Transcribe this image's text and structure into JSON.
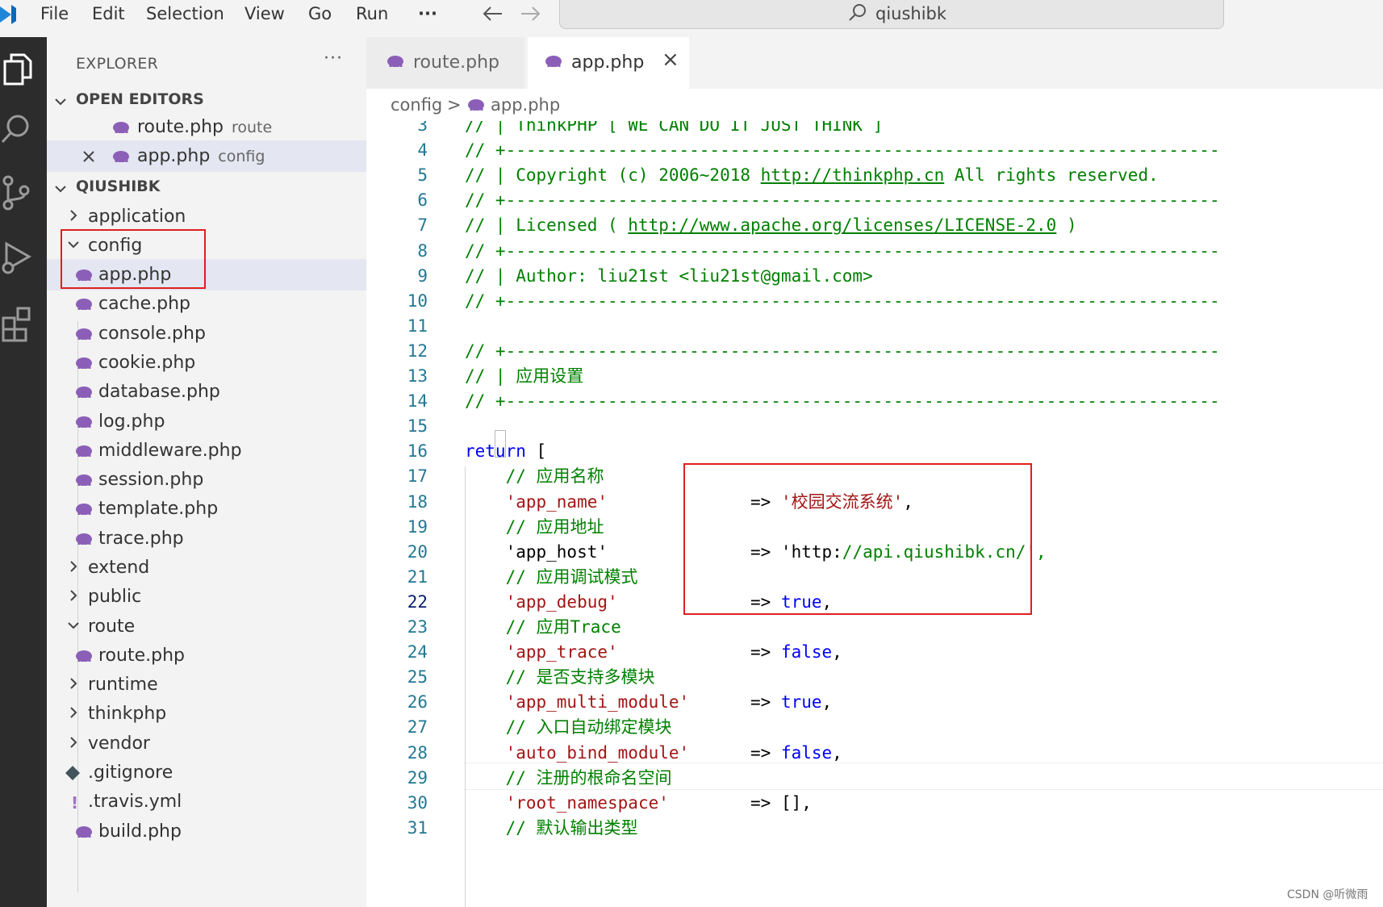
{
  "menu": {
    "items": [
      "File",
      "Edit",
      "Selection",
      "View",
      "Go",
      "Run",
      "···"
    ],
    "back_icon": "arrow-left-icon",
    "forward_icon": "arrow-right-icon"
  },
  "command_center": {
    "text": "qiushibk",
    "icon": "search-icon"
  },
  "activity_bar": {
    "icons": [
      "files-icon",
      "search-icon",
      "source-control-icon",
      "run-debug-icon",
      "extensions-icon"
    ]
  },
  "explorer": {
    "title": "EXPLORER",
    "more": "···",
    "open_editors": {
      "title": "OPEN EDITORS",
      "items": [
        {
          "name": "route.php",
          "folder": "route"
        },
        {
          "name": "app.php",
          "folder": "config"
        }
      ]
    },
    "workspace": {
      "title": "QIUSHIBK",
      "tree": [
        {
          "label": "application",
          "kind": "folder-collapsed"
        },
        {
          "label": "config",
          "kind": "folder-expanded"
        },
        {
          "label": "app.php",
          "kind": "php-file"
        },
        {
          "label": "cache.php",
          "kind": "php-file"
        },
        {
          "label": "console.php",
          "kind": "php-file"
        },
        {
          "label": "cookie.php",
          "kind": "php-file"
        },
        {
          "label": "database.php",
          "kind": "php-file"
        },
        {
          "label": "log.php",
          "kind": "php-file"
        },
        {
          "label": "middleware.php",
          "kind": "php-file"
        },
        {
          "label": "session.php",
          "kind": "php-file"
        },
        {
          "label": "template.php",
          "kind": "php-file"
        },
        {
          "label": "trace.php",
          "kind": "php-file"
        },
        {
          "label": "extend",
          "kind": "folder-collapsed"
        },
        {
          "label": "public",
          "kind": "folder-collapsed"
        },
        {
          "label": "route",
          "kind": "folder-expanded"
        },
        {
          "label": "route.php",
          "kind": "php-file"
        },
        {
          "label": "runtime",
          "kind": "folder-collapsed"
        },
        {
          "label": "thinkphp",
          "kind": "folder-collapsed"
        },
        {
          "label": "vendor",
          "kind": "folder-collapsed"
        },
        {
          "label": ".gitignore",
          "kind": "git-file"
        },
        {
          "label": ".travis.yml",
          "kind": "yml-file"
        },
        {
          "label": "build.php",
          "kind": "php-file"
        }
      ]
    }
  },
  "tabs": [
    {
      "label": "route.php",
      "active": false
    },
    {
      "label": "app.php",
      "active": true,
      "close": "×"
    }
  ],
  "breadcrumb": {
    "folder": "config",
    "separator": ">",
    "file": "app.php"
  },
  "editor": {
    "active_line": 22,
    "lines": [
      {
        "n": "3",
        "text": "// | ThinkPHP [ WE CAN DO IT JUST THINK ]"
      },
      {
        "n": "4",
        "text": "// +----------------------------------------------------------------------"
      },
      {
        "n": "5",
        "text": "// | Copyright (c) 2006~2018 http://thinkphp.cn All rights reserved."
      },
      {
        "n": "6",
        "text": "// +----------------------------------------------------------------------"
      },
      {
        "n": "7",
        "text": "// | Licensed ( http://www.apache.org/licenses/LICENSE-2.0 )"
      },
      {
        "n": "8",
        "text": "// +----------------------------------------------------------------------"
      },
      {
        "n": "9",
        "text": "// | Author: liu21st <liu21st@gmail.com>"
      },
      {
        "n": "10",
        "text": "// +----------------------------------------------------------------------"
      },
      {
        "n": "11",
        "text": ""
      },
      {
        "n": "12",
        "text": "// +----------------------------------------------------------------------"
      },
      {
        "n": "13",
        "text": "// | 应用设置"
      },
      {
        "n": "14",
        "text": "// +----------------------------------------------------------------------"
      },
      {
        "n": "15",
        "text": ""
      },
      {
        "n": "16",
        "text": "return ["
      },
      {
        "n": "17",
        "text": "    // 应用名称"
      },
      {
        "n": "18",
        "text": "    'app_name'              => '校园交流系统',"
      },
      {
        "n": "19",
        "text": "    // 应用地址"
      },
      {
        "n": "20",
        "text": "    'app_host'              => 'http://api.qiushibk.cn/',"
      },
      {
        "n": "21",
        "text": "    // 应用调试模式"
      },
      {
        "n": "22",
        "text": "    'app_debug'             => true,"
      },
      {
        "n": "23",
        "text": "    // 应用Trace"
      },
      {
        "n": "24",
        "text": "    'app_trace'             => false,"
      },
      {
        "n": "25",
        "text": "    // 是否支持多模块"
      },
      {
        "n": "26",
        "text": "    'app_multi_module'      => true,"
      },
      {
        "n": "27",
        "text": "    // 入口自动绑定模块"
      },
      {
        "n": "28",
        "text": "    'auto_bind_module'      => false,"
      },
      {
        "n": "29",
        "text": "    // 注册的根命名空间"
      },
      {
        "n": "30",
        "text": "    'root_namespace'        => [],"
      },
      {
        "n": "31",
        "text": "    // 默认输出类型"
      }
    ]
  },
  "watermark": "CSDN @听微雨"
}
